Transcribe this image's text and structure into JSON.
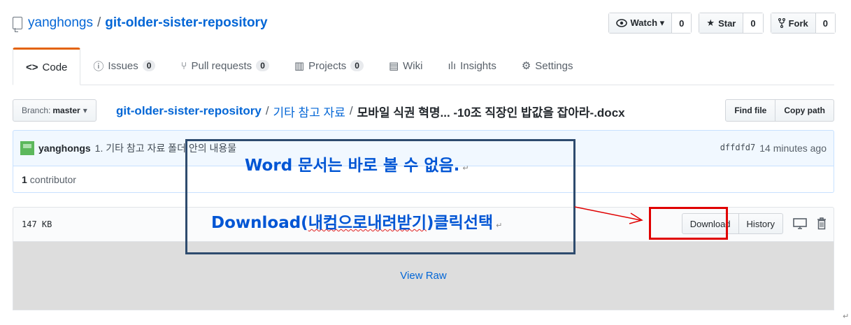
{
  "repo": {
    "owner": "yanghongs",
    "separator": "/",
    "name": "git-older-sister-repository"
  },
  "actions": {
    "watch": {
      "label": "Watch ▾",
      "count": "0"
    },
    "star": {
      "label": "Star",
      "count": "0"
    },
    "fork": {
      "label": "Fork",
      "count": "0"
    }
  },
  "tabs": [
    {
      "label": "Code",
      "icon": "<>"
    },
    {
      "label": "Issues",
      "count": "0"
    },
    {
      "label": "Pull requests",
      "count": "0"
    },
    {
      "label": "Projects",
      "count": "0"
    },
    {
      "label": "Wiki"
    },
    {
      "label": "Insights"
    },
    {
      "label": "Settings"
    }
  ],
  "branch": {
    "prefix": "Branch:",
    "name": "master"
  },
  "breadcrumb": {
    "root": "git-older-sister-repository",
    "folder": "기타 참고 자료",
    "file": "모바일 식권 혁명... -10조 직장인 밥값을 잡아라-.docx"
  },
  "file_nav": {
    "find": "Find file",
    "copy": "Copy path"
  },
  "commit": {
    "author": "yanghongs",
    "message": "1. 기타 참고 자료 폴더 안의 내용물",
    "sha": "dffdfd7",
    "time": "14 minutes ago"
  },
  "contributors": {
    "count": "1",
    "label": "contributor"
  },
  "file": {
    "size": "147 KB",
    "download": "Download",
    "history": "History",
    "view_raw": "View Raw"
  },
  "annotation": {
    "line1": "Word 문서는 바로 볼 수 없음.",
    "line2_prefix": "Download(",
    "line2_underlined": "내컴으로내려받기",
    "line2_suffix": ")클릭선택",
    "return_mark": "↵",
    "arrow_color": "#e00000",
    "text_color": "#0055d4"
  }
}
